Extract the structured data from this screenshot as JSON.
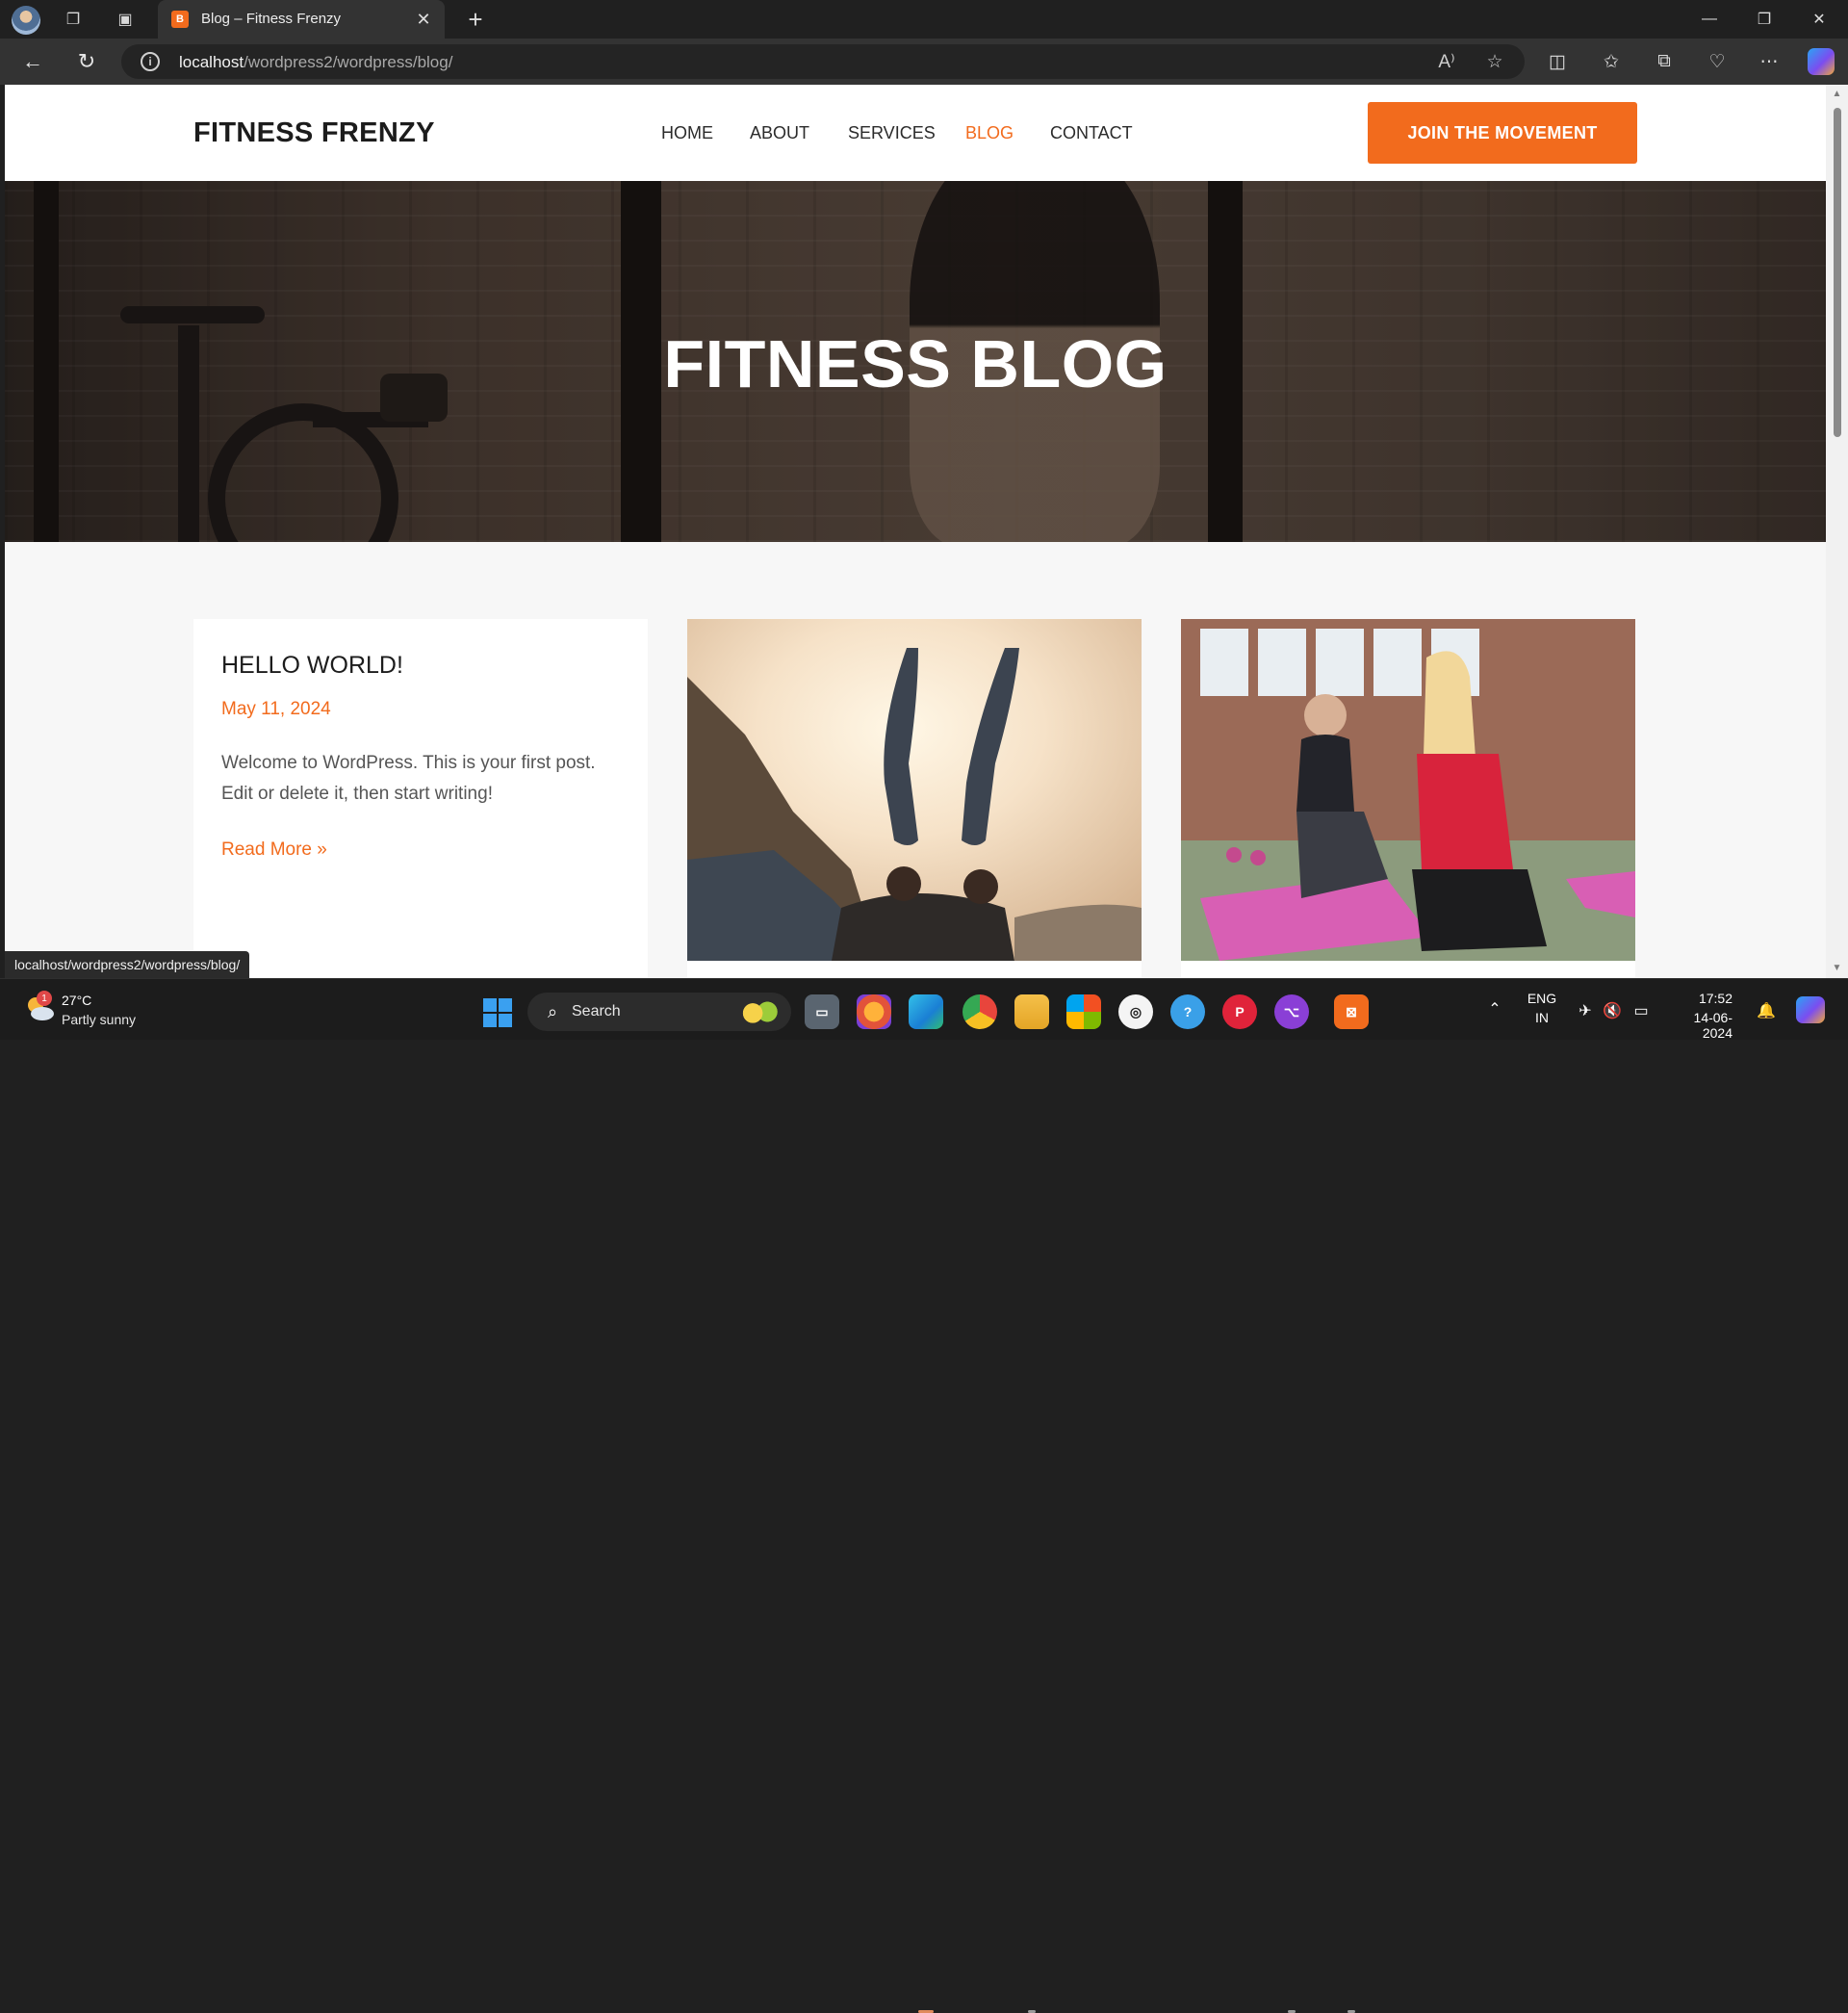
{
  "browser": {
    "tab_title": "Blog – Fitness Frenzy",
    "tab_favicon_text": "B",
    "url_host": "localhost",
    "url_path": "/wordpress2/wordpress/blog/",
    "status_url": "localhost/wordpress2/wordpress/blog/"
  },
  "site": {
    "logo": "FITNESS FRENZY",
    "nav": [
      {
        "label": "HOME"
      },
      {
        "label": "ABOUT"
      },
      {
        "label": "SERVICES"
      },
      {
        "label": "BLOG"
      },
      {
        "label": "CONTACT"
      }
    ],
    "active_nav": "BLOG",
    "cta": "JOIN THE MOVEMENT",
    "hero_title": "FITNESS BLOG",
    "accent_color": "#f26b1d"
  },
  "posts": [
    {
      "title": "HELLO WORLD!",
      "date": "May 11, 2024",
      "excerpt": "Welcome to WordPress. This is your first post. Edit or delete it, then start writing!",
      "read_more": "Read More »"
    }
  ],
  "taskbar": {
    "weather_temp": "27°C",
    "weather_desc": "Partly sunny",
    "weather_badge": "1",
    "search_label": "Search",
    "lang_top": "ENG",
    "lang_bottom": "IN",
    "time": "17:52",
    "date": "14-06-2024"
  }
}
